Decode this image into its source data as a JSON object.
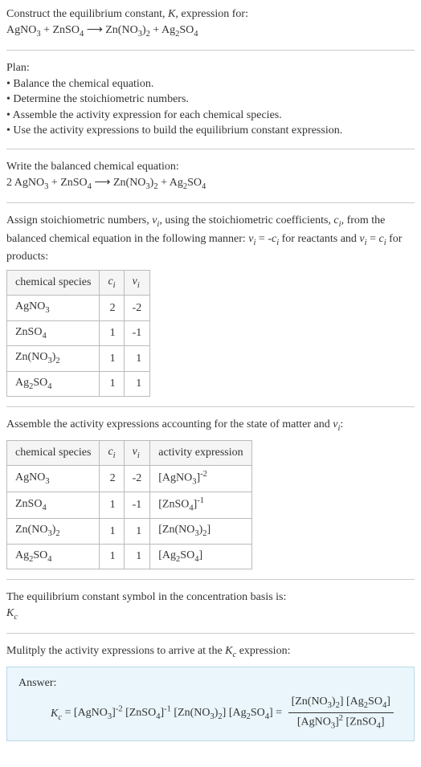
{
  "intro": {
    "line1": "Construct the equilibrium constant, K, expression for:",
    "equation": "AgNO₃ + ZnSO₄ ⟶ Zn(NO₃)₂ + Ag₂SO₄"
  },
  "plan": {
    "heading": "Plan:",
    "items": [
      "Balance the chemical equation.",
      "Determine the stoichiometric numbers.",
      "Assemble the activity expression for each chemical species.",
      "Use the activity expressions to build the equilibrium constant expression."
    ]
  },
  "balanced": {
    "heading": "Write the balanced chemical equation:",
    "equation": "2 AgNO₃ + ZnSO₄ ⟶ Zn(NO₃)₂ + Ag₂SO₄"
  },
  "assign": {
    "text": "Assign stoichiometric numbers, νᵢ, using the stoichiometric coefficients, cᵢ, from the balanced chemical equation in the following manner: νᵢ = -cᵢ for reactants and νᵢ = cᵢ for products:",
    "headers": [
      "chemical species",
      "cᵢ",
      "νᵢ"
    ],
    "rows": [
      [
        "AgNO₃",
        "2",
        "-2"
      ],
      [
        "ZnSO₄",
        "1",
        "-1"
      ],
      [
        "Zn(NO₃)₂",
        "1",
        "1"
      ],
      [
        "Ag₂SO₄",
        "1",
        "1"
      ]
    ]
  },
  "assemble": {
    "text": "Assemble the activity expressions accounting for the state of matter and νᵢ:",
    "headers": [
      "chemical species",
      "cᵢ",
      "νᵢ",
      "activity expression"
    ],
    "rows": [
      [
        "AgNO₃",
        "2",
        "-2",
        "[AgNO₃]⁻²"
      ],
      [
        "ZnSO₄",
        "1",
        "-1",
        "[ZnSO₄]⁻¹"
      ],
      [
        "Zn(NO₃)₂",
        "1",
        "1",
        "[Zn(NO₃)₂]"
      ],
      [
        "Ag₂SO₄",
        "1",
        "1",
        "[Ag₂SO₄]"
      ]
    ]
  },
  "symbol": {
    "line1": "The equilibrium constant symbol in the concentration basis is:",
    "line2": "K_c"
  },
  "multiply": {
    "text": "Mulitply the activity expressions to arrive at the K_c expression:"
  },
  "answer": {
    "label": "Answer:",
    "lhs": "K_c = [AgNO₃]⁻² [ZnSO₄]⁻¹ [Zn(NO₃)₂] [Ag₂SO₄] = ",
    "frac_num": "[Zn(NO₃)₂] [Ag₂SO₄]",
    "frac_den": "[AgNO₃]² [ZnSO₄]"
  }
}
